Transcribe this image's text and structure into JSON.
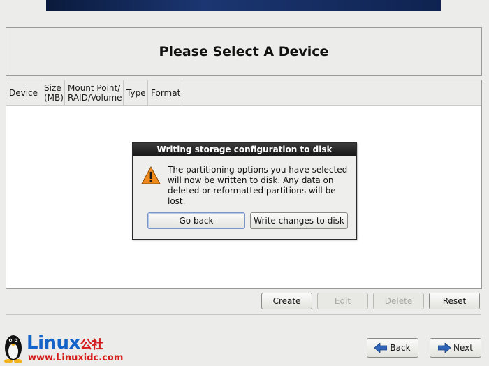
{
  "page_title": "Please Select A Device",
  "table": {
    "columns": [
      {
        "line1": "Device",
        "line2": ""
      },
      {
        "line1": "Size",
        "line2": "(MB)"
      },
      {
        "line1": "Mount Point/",
        "line2": "RAID/Volume"
      },
      {
        "line1": "Type",
        "line2": ""
      },
      {
        "line1": "Format",
        "line2": ""
      }
    ]
  },
  "dialog": {
    "title": "Writing storage configuration to disk",
    "icon": "warning-icon",
    "message_lines": [
      "The partitioning options you have selected",
      "will now be written to disk.  Any data on",
      "deleted or reformatted partitions will be lost."
    ],
    "go_back_label": "Go back",
    "write_label": "Write changes to disk"
  },
  "actions": {
    "create": "Create",
    "edit": "Edit",
    "delete": "Delete",
    "reset": "Reset"
  },
  "nav": {
    "back": "Back",
    "next": "Next"
  },
  "watermark": {
    "brand": "Linux",
    "brand_suffix": "公社",
    "url": "www.Linuxidc.com"
  },
  "colors": {
    "accent": "#1463c8",
    "watermark_red": "#d41c1c",
    "warning": "#f08a1c"
  }
}
